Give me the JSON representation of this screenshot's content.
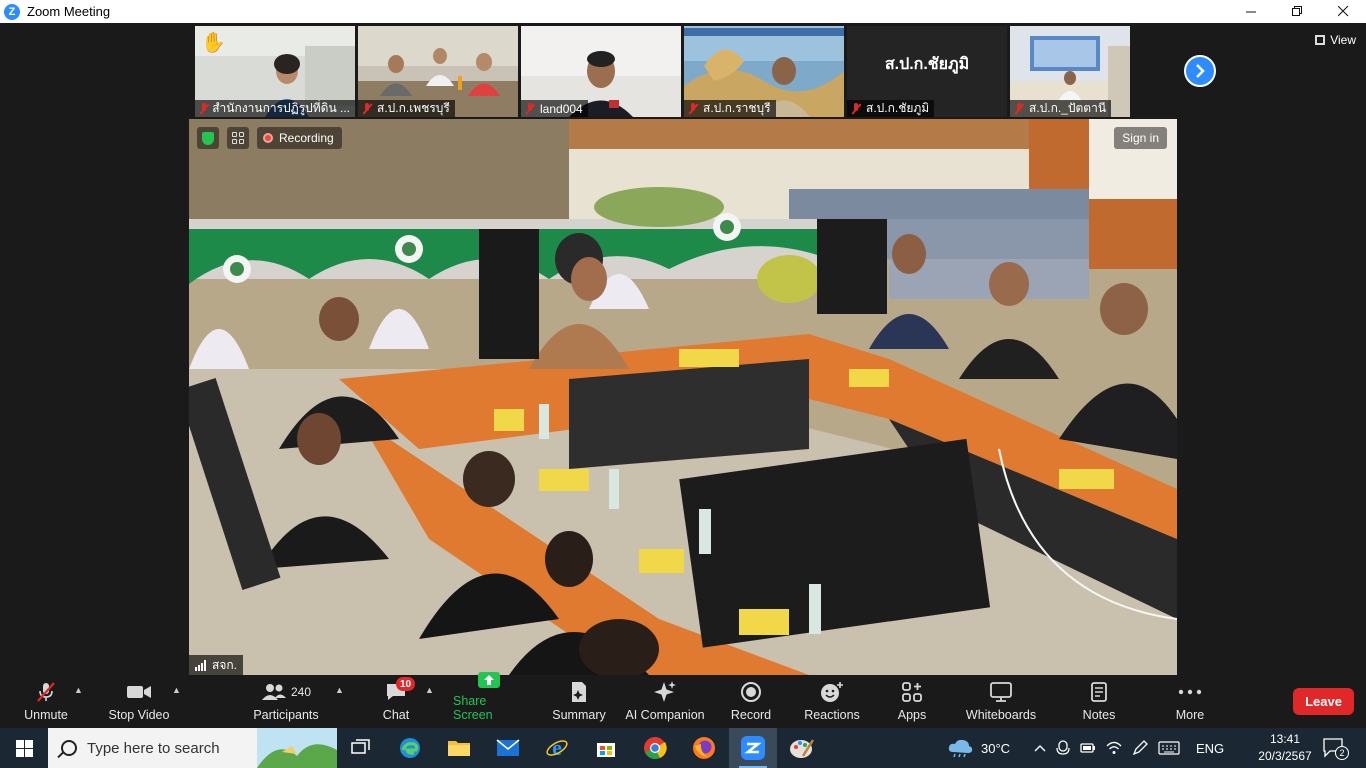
{
  "window": {
    "title": "Zoom Meeting",
    "logo_letter": "Z"
  },
  "thumbnails": [
    {
      "name": "สำนักงานการปฏิรูปที่ดิน ...",
      "raised_hand": true,
      "hand_glyph": "✋",
      "muted": true
    },
    {
      "name": "ส.ป.ก.เพชรบุรี",
      "muted": true
    },
    {
      "name": "land004",
      "muted": true
    },
    {
      "name": "ส.ป.ก.ราชบุรี",
      "muted": true
    },
    {
      "name": "ส.ป.ก.ชัยภูมิ",
      "display_text": "ส.ป.ก.ชัยภูมิ",
      "video_off": true,
      "muted": true
    },
    {
      "name": "ส.ป.ก._ปัตตานี",
      "muted": true
    }
  ],
  "view_button": {
    "label": "View"
  },
  "main_video": {
    "recording_label": "Recording",
    "sign_in_label": "Sign in",
    "speaker_name": "สจก."
  },
  "toolbar": {
    "unmute": "Unmute",
    "stop_video": "Stop Video",
    "participants_label": "Participants",
    "participants_count": "240",
    "chat": "Chat",
    "chat_badge": "10",
    "share_screen": "Share Screen",
    "summary": "Summary",
    "ai_companion": "AI Companion",
    "record": "Record",
    "reactions": "Reactions",
    "apps": "Apps",
    "whiteboards": "Whiteboards",
    "notes": "Notes",
    "more": "More",
    "leave": "Leave"
  },
  "taskbar": {
    "search_placeholder": "Type here to search",
    "weather": "30°C",
    "language": "ENG",
    "time": "13:41",
    "date": "20/3/2567",
    "notification_count": "2"
  },
  "colors": {
    "zoom_blue": "#2d8cff",
    "leave_red": "#e02828",
    "share_green": "#23c552",
    "toolbar_bg": "#1a1a1a",
    "taskbar_bg": "#1b2733"
  }
}
